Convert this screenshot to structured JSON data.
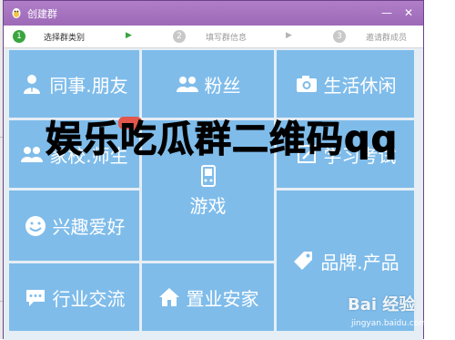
{
  "window": {
    "title": "创建群",
    "controls": {
      "minimize_icon": "minimize-icon",
      "close_icon": "close-icon"
    }
  },
  "steps": [
    {
      "number": "1",
      "label": "选择群类别",
      "state": "active"
    },
    {
      "number": "2",
      "label": "填写群信息",
      "state": "inactive"
    },
    {
      "number": "3",
      "label": "邀请群成员",
      "state": "inactive"
    }
  ],
  "step_arrow": "▶",
  "categories": [
    {
      "label": "同事.朋友",
      "icon": "person-icon"
    },
    {
      "label": "粉丝",
      "icon": "people-icon"
    },
    {
      "label": "生活休闲",
      "icon": "camera-icon"
    },
    {
      "label": "家校.师生",
      "icon": "people-icon"
    },
    {
      "label": "游戏",
      "icon": "gamepad-icon"
    },
    {
      "label": "学习考试",
      "icon": "pencil-icon"
    },
    {
      "label": "兴趣爱好",
      "icon": "smiley-icon"
    },
    {
      "label": "品牌.产品",
      "icon": "tag-icon"
    },
    {
      "label": "行业交流",
      "icon": "chat-icon"
    },
    {
      "label": "置业安家",
      "icon": "house-icon"
    }
  ],
  "overlay_caption": "娱乐吃瓜群二维码qq",
  "watermark": {
    "logo": "Bai 经验",
    "url": "jingyan.baidu.com"
  },
  "colors": {
    "tile": "#7fbcea",
    "titlebar": "#9d69b8",
    "step_active": "#39a53f"
  }
}
